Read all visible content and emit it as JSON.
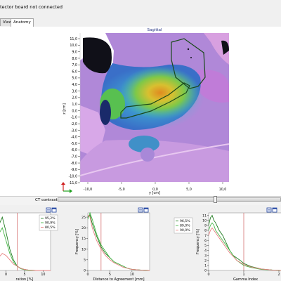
{
  "status": {
    "text": "tector board not connected"
  },
  "tabs": [
    {
      "label": "View",
      "active": false
    },
    {
      "label": "Anatomy",
      "active": true
    }
  ],
  "viewer": {
    "title": "Sagittal",
    "z_label": "z [cm]",
    "y_label": "y [cm]",
    "z_ticks": [
      "11,0",
      "10,0",
      "9,0",
      "8,0",
      "7,0",
      "6,0",
      "5,0",
      "4,0",
      "3,0",
      "2,0",
      "1,0",
      "0,0",
      "-1,0",
      "-2,0",
      "-3,0",
      "-4,0",
      "-5,0",
      "-6,0",
      "-7,0",
      "-8,0",
      "-9,0",
      "-10,0",
      "-11,0"
    ],
    "y_ticks": [
      "-10,0",
      "-5,0",
      "0,0",
      "5,0",
      "10,0"
    ]
  },
  "ct_contrast": {
    "label": "CT contrast",
    "level": 0.71
  },
  "charts": [
    {
      "xlabel": "ration [%]",
      "ylabel": "",
      "x_ticks": [
        "0",
        "5",
        "10"
      ],
      "y_ticks": [],
      "legend": [
        "95,2%",
        "90,9%",
        "80,5%"
      ]
    },
    {
      "xlabel": "Distance to Agreement [mm]",
      "ylabel": "Frequency [%]",
      "x_ticks": [
        "0",
        "5",
        "10"
      ],
      "y_ticks": [
        "25",
        "20",
        "15",
        "10",
        "5",
        "0"
      ],
      "legend": []
    },
    {
      "xlabel": "Gamma Index",
      "ylabel": "Frequency [%]",
      "x_ticks": [
        "0",
        "1",
        "2"
      ],
      "y_ticks": [
        "11",
        "10",
        "9",
        "8",
        "7",
        "6",
        "5",
        "4",
        "3",
        "2",
        "1",
        "0"
      ],
      "legend": [
        "96,5%",
        "89,0%",
        "90,0%"
      ]
    }
  ],
  "colors": {
    "dark_green": "#1f7a1f",
    "green": "#48b848",
    "pink": "#e88080",
    "threshold": "#d06060",
    "window_icon": "#1a3fa0"
  },
  "chart_data": [
    {
      "type": "line",
      "xlabel": "ration [%]",
      "x_range": [
        -2,
        12
      ],
      "y_range": [
        0,
        27
      ],
      "series": [
        {
          "name": "95,2%",
          "x": [
            -2,
            -1,
            0,
            1,
            2,
            3,
            4,
            5,
            6,
            8,
            10,
            12
          ],
          "y": [
            21,
            25,
            18,
            10,
            5,
            2,
            1,
            0.5,
            0.2,
            0,
            0,
            0
          ]
        },
        {
          "name": "90,9%",
          "x": [
            -2,
            -1,
            0,
            1,
            2,
            3,
            4,
            5,
            6,
            8,
            10,
            12
          ],
          "y": [
            17,
            20,
            14,
            8,
            4,
            2,
            0.8,
            0.3,
            0,
            0,
            0,
            0
          ]
        },
        {
          "name": "80,5%",
          "x": [
            -2,
            -1,
            0,
            1,
            2,
            3,
            4,
            5,
            6,
            8,
            10,
            12
          ],
          "y": [
            6,
            8,
            7,
            5,
            3,
            2,
            1,
            0.5,
            0.2,
            0,
            0,
            0
          ]
        }
      ],
      "threshold_x": 3
    },
    {
      "type": "line",
      "xlabel": "Distance to Agreement [mm]",
      "ylabel": "Frequency [%]",
      "x_range": [
        0,
        14
      ],
      "y_range": [
        0,
        27
      ],
      "series": [
        {
          "x": [
            0,
            0.5,
            1,
            2,
            3,
            4,
            5,
            6,
            7,
            8,
            9,
            10,
            12,
            14
          ],
          "y": [
            25,
            26,
            22,
            16,
            11,
            8,
            6,
            4,
            3,
            2,
            1,
            0.5,
            0.2,
            0
          ]
        },
        {
          "x": [
            0,
            0.5,
            1,
            2,
            3,
            4,
            5,
            6,
            7,
            8,
            9,
            10,
            12,
            14
          ],
          "y": [
            24,
            27,
            24,
            17,
            12,
            9,
            6,
            4,
            3,
            2,
            1,
            0.5,
            0.2,
            0
          ]
        },
        {
          "x": [
            0,
            0.5,
            1,
            2,
            3,
            4,
            5,
            6,
            7,
            8,
            9,
            10,
            12,
            14
          ],
          "y": [
            26,
            25,
            20,
            14,
            10,
            7,
            5,
            3.5,
            2.5,
            1.5,
            1,
            0.5,
            0.2,
            0
          ]
        }
      ],
      "threshold_x": 3
    },
    {
      "type": "line",
      "xlabel": "Gamma Index",
      "ylabel": "Frequency [%]",
      "x_range": [
        0,
        2.1
      ],
      "y_range": [
        0,
        11.5
      ],
      "series": [
        {
          "name": "96,5%",
          "x": [
            0,
            0.05,
            0.1,
            0.15,
            0.2,
            0.3,
            0.4,
            0.5,
            0.6,
            0.7,
            0.8,
            0.9,
            1.0,
            1.2,
            1.5,
            1.8,
            2.1
          ],
          "y": [
            9,
            10.5,
            11,
            10,
            9.5,
            8,
            7,
            5.5,
            4,
            3,
            2.5,
            2,
            1.4,
            0.8,
            0.3,
            0.1,
            0
          ]
        },
        {
          "name": "89,0%",
          "x": [
            0,
            0.05,
            0.1,
            0.15,
            0.2,
            0.3,
            0.4,
            0.5,
            0.6,
            0.7,
            0.8,
            0.9,
            1.0,
            1.2,
            1.5,
            1.8,
            2.1
          ],
          "y": [
            8,
            9,
            9.5,
            9,
            8,
            7,
            6,
            5,
            4,
            3,
            2,
            1.5,
            1,
            0.6,
            0.2,
            0.1,
            0
          ]
        },
        {
          "name": "90,0%",
          "x": [
            0,
            0.05,
            0.1,
            0.15,
            0.2,
            0.3,
            0.4,
            0.5,
            0.6,
            0.7,
            0.8,
            0.9,
            1.0,
            1.2,
            1.5,
            1.8,
            2.1
          ],
          "y": [
            7,
            8,
            8.5,
            8,
            7.5,
            6.5,
            5.5,
            4.5,
            3.5,
            2.8,
            2,
            1.6,
            1.2,
            0.7,
            0.3,
            0.1,
            0
          ]
        }
      ],
      "threshold_x": 1
    }
  ]
}
